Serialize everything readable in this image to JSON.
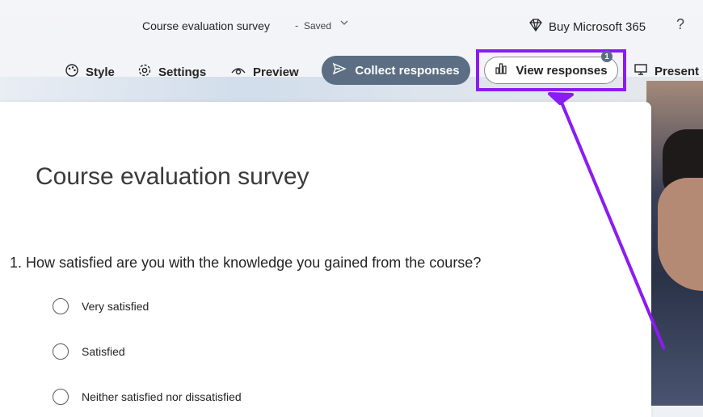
{
  "titlebar": {
    "doc_title": "Course evaluation survey",
    "separator": "-",
    "status": "Saved",
    "caret_icon": "chevron-down-icon",
    "buy_label": "Buy Microsoft 365",
    "help_label": "?"
  },
  "toolbar": {
    "style_label": "Style",
    "settings_label": "Settings",
    "preview_label": "Preview",
    "collect_label": "Collect responses",
    "view_label": "View responses",
    "view_badge": "1",
    "present_label": "Present"
  },
  "survey": {
    "title": "Course evaluation survey",
    "question": "1. How satisfied are you with the knowledge you gained from the course?",
    "options": [
      "Very satisfied",
      "Satisfied",
      "Neither satisfied nor dissatisfied"
    ]
  },
  "colors": {
    "highlight": "#8a1cf2",
    "collect_bg": "#5b6e83"
  }
}
